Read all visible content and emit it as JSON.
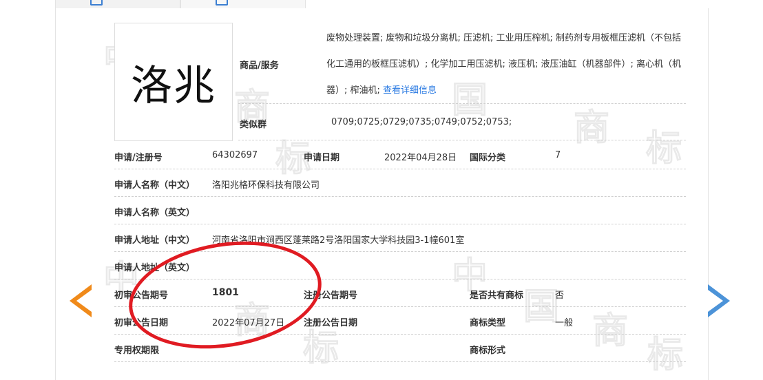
{
  "trademark": {
    "logo_text": "洛兆",
    "goods_label": "商品/服务",
    "goods_text": "废物处理装置; 废物和垃圾分离机; 压滤机; 工业用压榨机; 制药剂专用板框压滤机（不包括化工通用的板框压滤机）; 化学加工用压滤机; 液压机; 液压油缸（机器部件）; 离心机（机器）; 榨油机;",
    "detail_link": "查看详细信息",
    "similar_label": "类似群",
    "similar_value": "0709;0725;0729;0735;0749;0752;0753;"
  },
  "fields": {
    "reg_no_label": "申请/注册号",
    "reg_no_value": "64302697",
    "app_date_label": "申请日期",
    "app_date_value": "2022年04月28日",
    "intl_class_label": "国际分类",
    "intl_class_value": "7",
    "applicant_cn_label": "申请人名称（中文）",
    "applicant_cn_value": "洛阳兆格环保科技有限公司",
    "applicant_en_label": "申请人名称（英文）",
    "address_cn_label": "申请人地址（中文）",
    "address_cn_value": "河南省洛阳市涧西区蓬莱路2号洛阳国家大学科技园3-1幢601室",
    "address_en_label": "申请人地址（英文）",
    "prelim_no_label": "初审公告期号",
    "prelim_no_value": "1801",
    "reg_pub_no_label": "注册公告期号",
    "shared_label": "是否共有商标",
    "shared_value": "否",
    "prelim_date_label": "初审公告日期",
    "prelim_date_value": "2022年07月27日",
    "reg_pub_date_label": "注册公告日期",
    "type_label": "商标类型",
    "type_value": "一般",
    "exclusive_label": "专用权期限",
    "form_label": "商标形式"
  },
  "watermark": [
    "中",
    "国",
    "商",
    "标"
  ],
  "colors": {
    "accent_link": "#2a7ae2",
    "prev_arrow": "#f08a1a",
    "next_arrow": "#4c93d8",
    "highlight_ellipse": "#e01b22"
  }
}
